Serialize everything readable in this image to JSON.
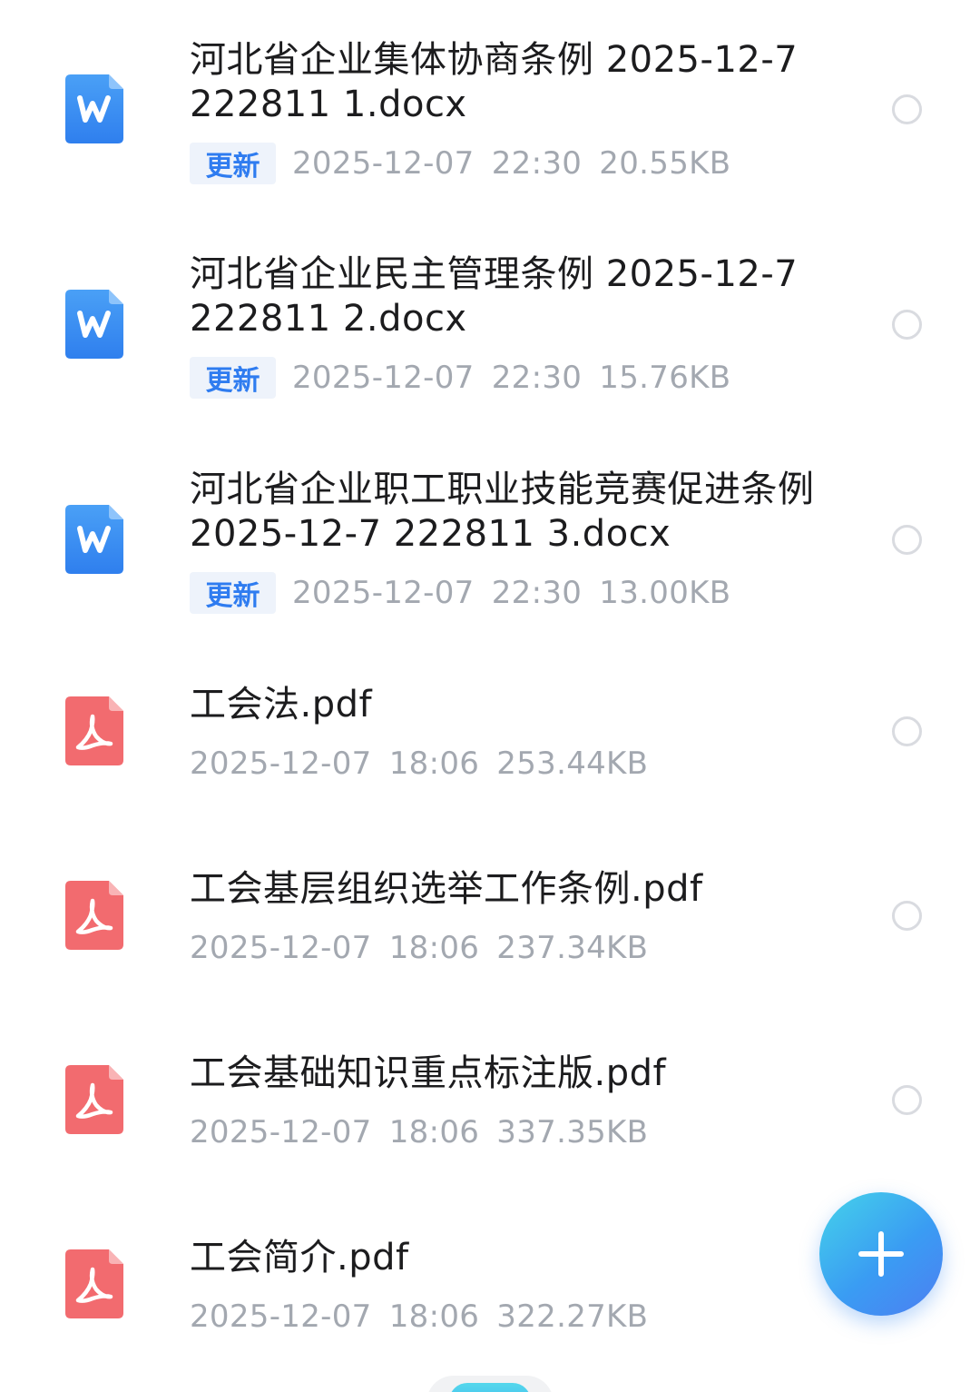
{
  "files": [
    {
      "type": "docx",
      "icon": "word-doc-icon",
      "name_line1": "河北省企业集体协商条例 2025-12-7",
      "name_line2": "222811 1.docx",
      "badge": "更新",
      "meta": "2025-12-07 22:30 20.55KB"
    },
    {
      "type": "docx",
      "icon": "word-doc-icon",
      "name_line1": "河北省企业民主管理条例 2025-12-7",
      "name_line2": "222811 2.docx",
      "badge": "更新",
      "meta": "2025-12-07 22:30 15.76KB"
    },
    {
      "type": "docx",
      "icon": "word-doc-icon",
      "name_line1": "河北省企业职工职业技能竞赛促进条例",
      "name_line2": "2025-12-7 222811 3.docx",
      "badge": "更新",
      "meta": "2025-12-07 22:30 13.00KB"
    },
    {
      "type": "pdf",
      "icon": "pdf-doc-icon",
      "name_line1": "工会法.pdf",
      "meta": "2025-12-07 18:06 253.44KB"
    },
    {
      "type": "pdf",
      "icon": "pdf-doc-icon",
      "name_line1": "工会基层组织选举工作条例.pdf",
      "meta": "2025-12-07 18:06 237.34KB"
    },
    {
      "type": "pdf",
      "icon": "pdf-doc-icon",
      "name_line1": "工会基础知识重点标注版.pdf",
      "meta": "2025-12-07 18:06 337.35KB"
    },
    {
      "type": "pdf",
      "icon": "pdf-doc-icon",
      "name_line1": "工会简介.pdf",
      "meta": "2025-12-07 18:06 322.27KB"
    }
  ],
  "fab": {
    "icon": "plus-icon"
  },
  "colors": {
    "word_blue": "#3b8ff3",
    "pdf_red": "#f26b6f",
    "badge_text": "#2f7cf0",
    "badge_bg": "#eef3fb",
    "meta_gray": "#a3a8b0",
    "fab_gradient_start": "#45d3ea",
    "fab_gradient_end": "#4d7ef2"
  }
}
